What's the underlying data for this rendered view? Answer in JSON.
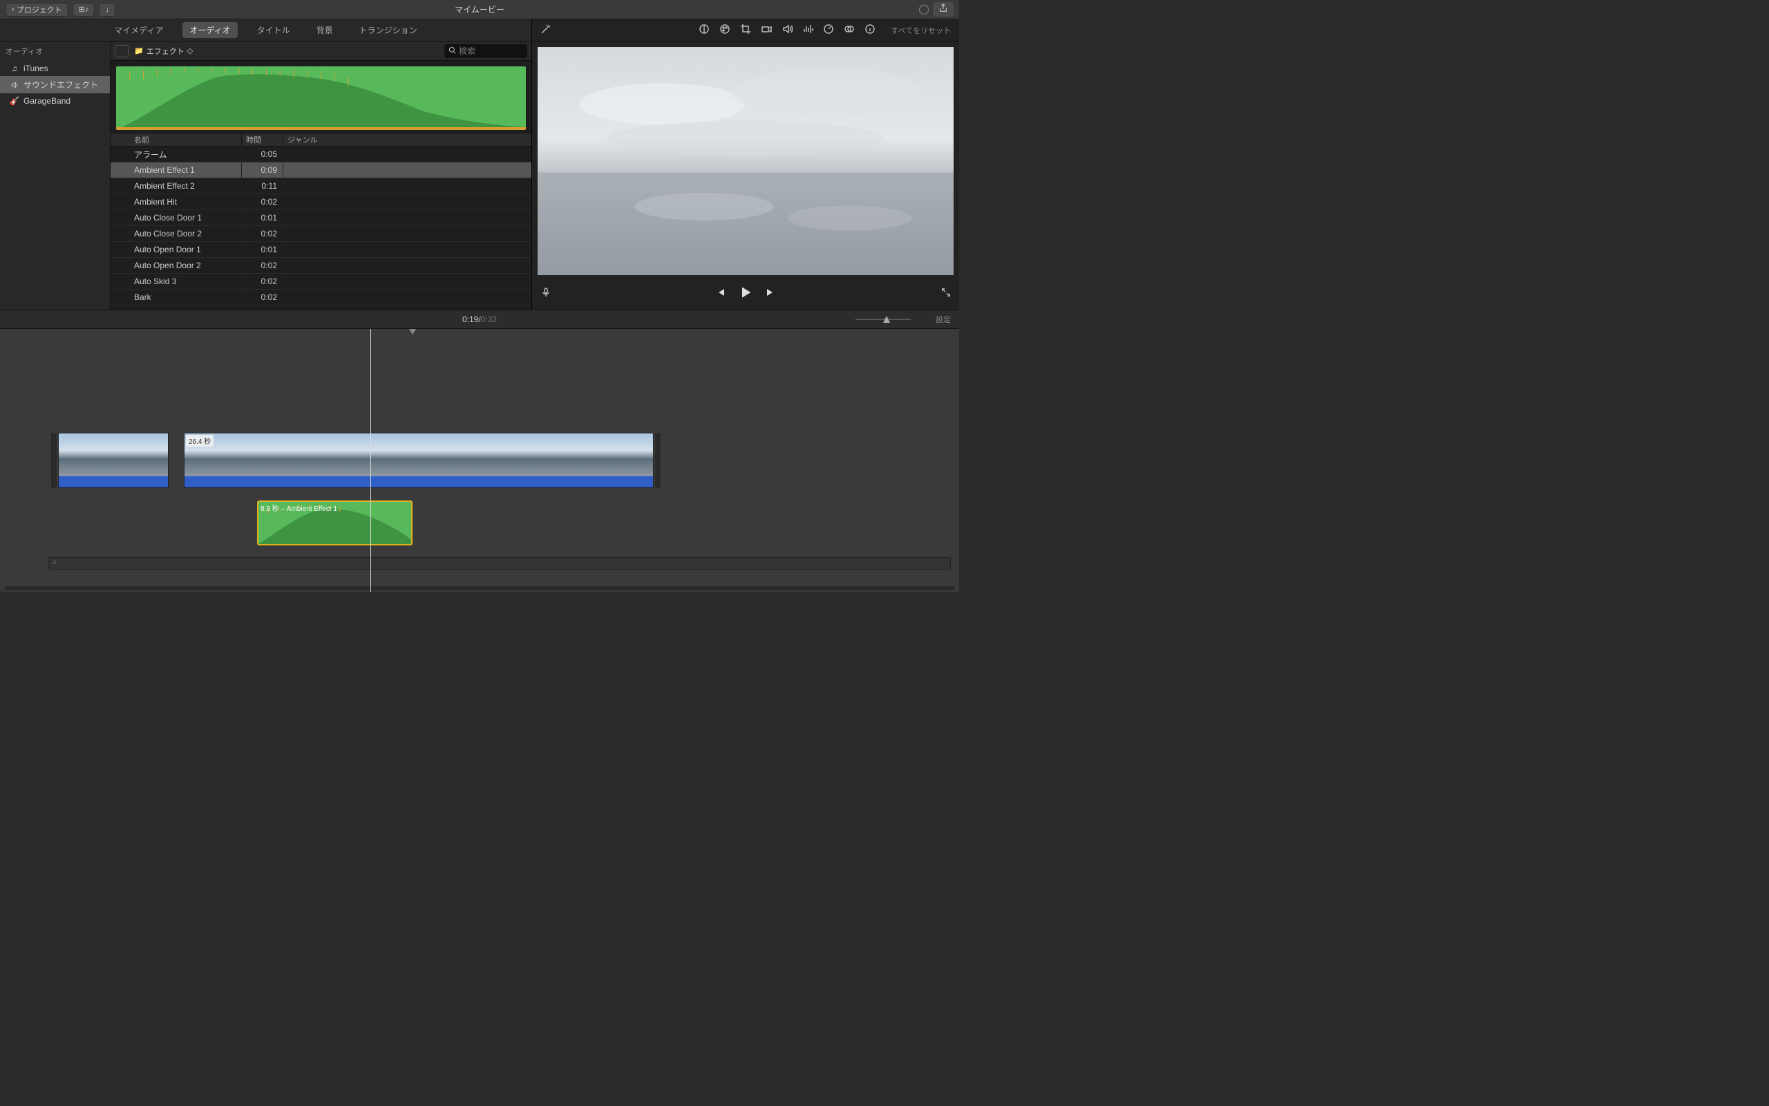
{
  "toolbar": {
    "back_label": "プロジェクト",
    "title": "マイムービー"
  },
  "tabs": {
    "my_media": "マイメディア",
    "audio": "オーディオ",
    "titles": "タイトル",
    "backgrounds": "背景",
    "transitions": "トランジション"
  },
  "sidebar": {
    "header": "オーディオ",
    "items": [
      {
        "label": "iTunes"
      },
      {
        "label": "サウンドエフェクト"
      },
      {
        "label": "GarageBand"
      }
    ]
  },
  "browser_toolbar": {
    "folder_label": "エフェクト",
    "search_placeholder": "検索"
  },
  "table_headers": {
    "name": "名前",
    "time": "時間",
    "genre": "ジャンル"
  },
  "audio_list": [
    {
      "name": "アラーム",
      "time": "0:05"
    },
    {
      "name": "Ambient Effect 1",
      "time": "0:09",
      "selected": true
    },
    {
      "name": "Ambient Effect 2",
      "time": "0:11"
    },
    {
      "name": "Ambient Hit",
      "time": "0:02"
    },
    {
      "name": "Auto Close Door 1",
      "time": "0:01"
    },
    {
      "name": "Auto Close Door 2",
      "time": "0:02"
    },
    {
      "name": "Auto Open Door 1",
      "time": "0:01"
    },
    {
      "name": "Auto Open Door 2",
      "time": "0:02"
    },
    {
      "name": "Auto Skid 3",
      "time": "0:02"
    },
    {
      "name": "Bark",
      "time": "0:02"
    }
  ],
  "adjust_bar": {
    "reset_label": "すべてをリセット"
  },
  "timeline": {
    "current": "0:19",
    "separator": " / ",
    "total": "0:32",
    "settings_label": "設定",
    "clip2_label": "26.4 秒",
    "audio_clip_label": "8.9 秒 – Ambient Effect 1"
  }
}
